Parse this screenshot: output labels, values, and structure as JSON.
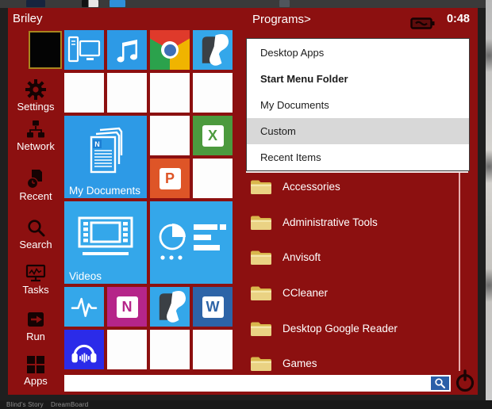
{
  "window": {
    "user_name": "Briley",
    "programs_label": "Programs>",
    "time": "0:48"
  },
  "sidebar": {
    "items": [
      {
        "id": "settings",
        "label": "Settings"
      },
      {
        "id": "network",
        "label": "Network"
      },
      {
        "id": "recent",
        "label": "Recent"
      },
      {
        "id": "search",
        "label": "Search"
      },
      {
        "id": "tasks",
        "label": "Tasks"
      },
      {
        "id": "run",
        "label": "Run"
      },
      {
        "id": "apps",
        "label": "Apps"
      }
    ]
  },
  "tiles": {
    "my_documents_label": "My Documents",
    "videos_label": "Videos",
    "mydocs_badge": "N",
    "excel_letter": "X",
    "powerpoint_letter": "P",
    "onenote_letter": "N",
    "word_letter": "W"
  },
  "dropdown": {
    "items": [
      {
        "label": "Desktop Apps"
      },
      {
        "label": "Start Menu Folder"
      },
      {
        "label": "My Documents"
      },
      {
        "label": "Custom"
      },
      {
        "label": "Recent Items"
      }
    ],
    "highlighted": "Custom"
  },
  "folders": {
    "items": [
      {
        "label": "Accessories"
      },
      {
        "label": "Administrative Tools"
      },
      {
        "label": "Anvisoft"
      },
      {
        "label": "CCleaner"
      },
      {
        "label": "Desktop Google Reader"
      },
      {
        "label": "Games"
      }
    ]
  },
  "search": {
    "value": "",
    "placeholder": ""
  },
  "taskbar": {
    "windows": [
      {
        "title": "Blind's Story"
      },
      {
        "title": "DreamBoard"
      }
    ]
  },
  "colors": {
    "menu_red": "#8C1010",
    "tile_blue": "#2D9AE6",
    "tile_blue_light": "#34A7EA",
    "excel_green": "#4C9A3E",
    "powerpoint_orange": "#DE5527",
    "onenote_magenta": "#B52589",
    "word_blue": "#2D64A7",
    "audio_indigo": "#2B2BE9",
    "search_button_blue": "#2A5FA8",
    "dropdown_highlight": "#D8D8D8",
    "folder_yellow": "#EAD283",
    "avatar_border": "#A8861E"
  }
}
